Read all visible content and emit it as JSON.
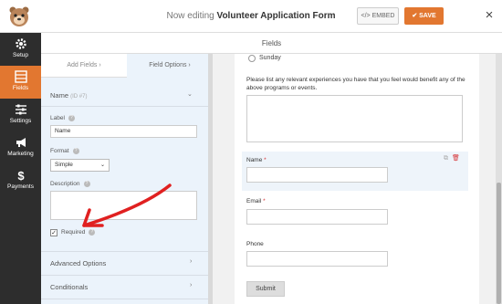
{
  "header": {
    "prefix": "Now editing",
    "form_name": "Volunteer Application Form",
    "embed_label": "EMBED",
    "save_label": "SAVE",
    "close_label": "×"
  },
  "nav": [
    {
      "label": "Setup",
      "icon": "gear-icon"
    },
    {
      "label": "Fields",
      "icon": "fields-icon",
      "active": true
    },
    {
      "label": "Settings",
      "icon": "sliders-icon"
    },
    {
      "label": "Marketing",
      "icon": "megaphone-icon"
    },
    {
      "label": "Payments",
      "icon": "dollar-icon"
    }
  ],
  "fields_header": "Fields",
  "panel": {
    "tabs": {
      "add": "Add Fields",
      "options": "Field Options"
    },
    "section_title": "Name",
    "section_id": "(ID #7)",
    "label_label": "Label",
    "label_value": "Name",
    "format_label": "Format",
    "format_value": "Simple",
    "description_label": "Description",
    "required_label": "Required",
    "required_checked": true,
    "advanced": "Advanced Options",
    "conditionals": "Conditionals"
  },
  "preview": {
    "radio_option": "Sunday",
    "question": "Please list any relevant experiences you have that you feel would benefit any of the above programs or events.",
    "name_label": "Name",
    "email_label": "Email",
    "phone_label": "Phone",
    "required_mark": "*",
    "submit_label": "Submit"
  },
  "colors": {
    "accent": "#e27730",
    "nav_bg": "#2d2d2d",
    "panel_bg": "#ebf3fb",
    "required": "#d63638"
  }
}
